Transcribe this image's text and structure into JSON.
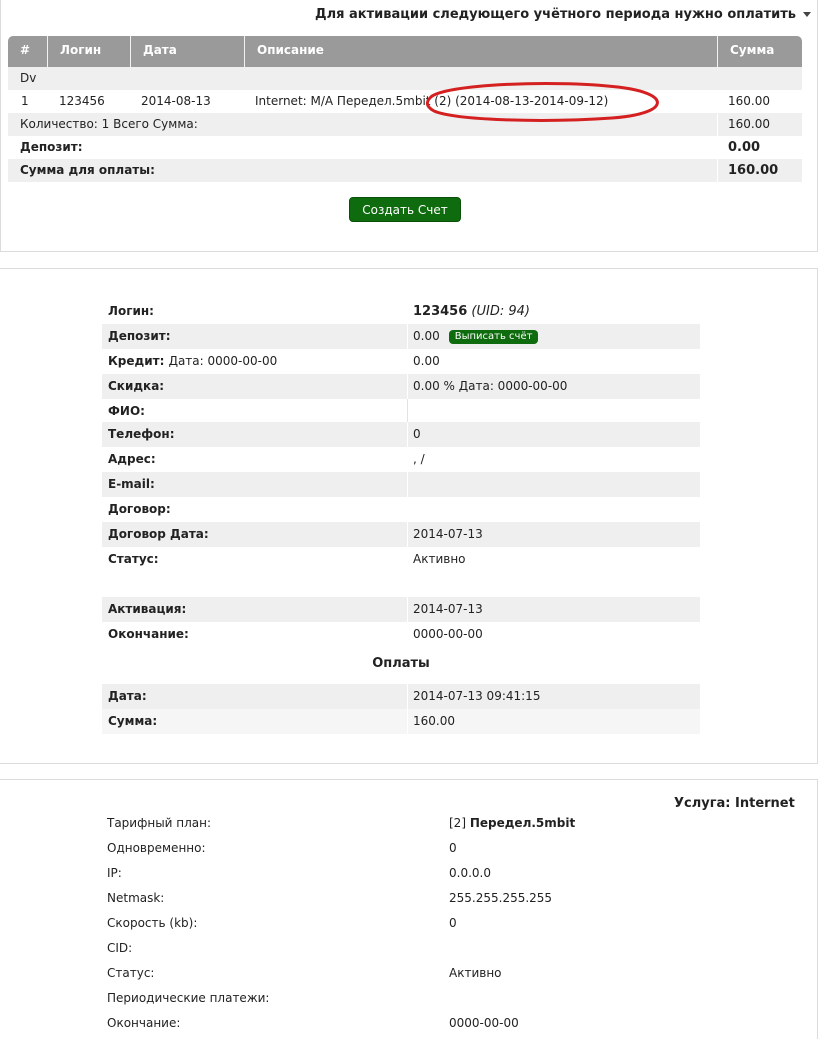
{
  "invoice": {
    "title": "Для активации следующего учётного периода нужно оплатить",
    "columns": [
      "#",
      "Логин",
      "Дата",
      "Описание",
      "Сумма"
    ],
    "group_label": "Dv",
    "row": {
      "num": "1",
      "login": "123456",
      "date": "2014-08-13",
      "description": "Internet: M/A Передел.5mbit (2) (2014-08-13-2014-09-12)",
      "sum": "160.00"
    },
    "summary_label": "Количество: 1 Всего Сумма:",
    "summary_value": "160.00",
    "deposit_label": "Депозит:",
    "deposit_value": "0.00",
    "pay_label": "Сумма для оплаты:",
    "pay_value": "160.00",
    "create_button": "Создать Счет"
  },
  "account": {
    "rows": [
      {
        "label": "Логин:",
        "value": "123456",
        "extra": "(UID: 94)"
      },
      {
        "label": "Депозит:",
        "value": "0.00",
        "button": "Выписать счёт"
      },
      {
        "label": "Кредит:",
        "label_extra": "Дата: 0000-00-00",
        "value": "0.00"
      },
      {
        "label": "Скидка:",
        "value": "0.00 % Дата: 0000-00-00"
      },
      {
        "label": "ФИО:",
        "value": ""
      },
      {
        "label": "Телефон:",
        "value": "0"
      },
      {
        "label": "Адрес:",
        "value": ", /"
      },
      {
        "label": "E-mail:",
        "value": ""
      },
      {
        "label": "Договор:",
        "value": ""
      },
      {
        "label": "Договор Дата:",
        "value": "2014-07-13"
      },
      {
        "label": "Статус:",
        "value": "Активно"
      },
      {
        "label": "Активация:",
        "value": "2014-07-13"
      },
      {
        "label": "Окончание:",
        "value": "0000-00-00"
      }
    ],
    "payments_heading": "Оплаты",
    "payments": [
      {
        "label": "Дата:",
        "value": "2014-07-13 09:41:15"
      },
      {
        "label": "Сумма:",
        "value": "160.00"
      }
    ]
  },
  "service": {
    "title": "Услуга: Internet",
    "rows": [
      {
        "label": "Тарифный план:",
        "value_prefix": "[2]",
        "value_bold": "Передел.5mbit"
      },
      {
        "label": "Одновременно:",
        "value": "0"
      },
      {
        "label": "IP:",
        "value": "0.0.0.0"
      },
      {
        "label": "Netmask:",
        "value": "255.255.255.255"
      },
      {
        "label": "Скорость (kb):",
        "value": "0"
      },
      {
        "label": "CID:",
        "value": ""
      },
      {
        "label": "Статус:",
        "value": "Активно"
      },
      {
        "label": "Периодические платежи:",
        "value": ""
      },
      {
        "label": "Окончание:",
        "value": "0000-00-00"
      }
    ]
  },
  "colors": {
    "header_gray": "#9a9a9a",
    "row_shade": "#efefef",
    "button_green": "#0e6b0e",
    "annotation_red": "#d42020"
  }
}
